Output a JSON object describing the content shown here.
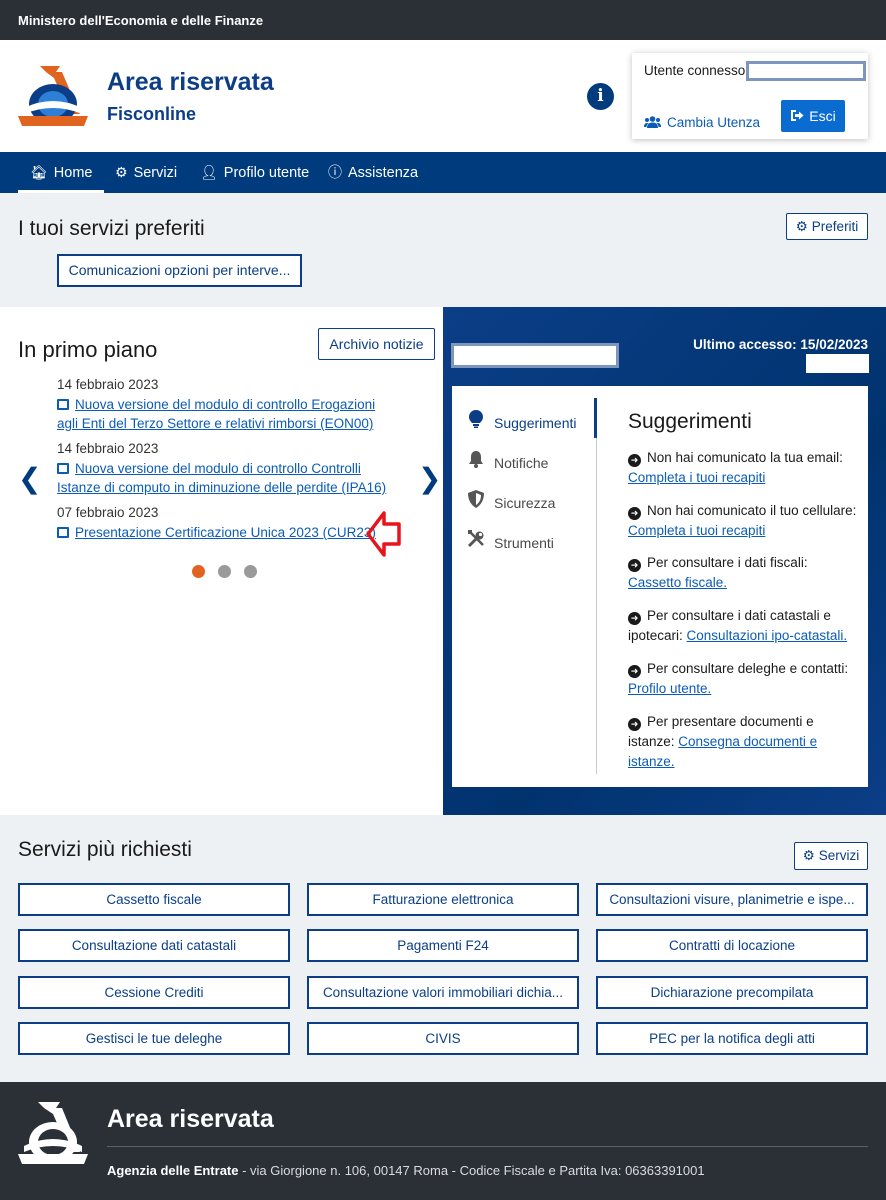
{
  "topbar": {
    "ministry": "Ministero dell'Economia e delle Finanze"
  },
  "header": {
    "title": "Area riservata",
    "subtitle": "Fisconline",
    "info_glyph": "i",
    "user_label": "Utente connesso:",
    "switch_user": "Cambia Utenza",
    "logout": "Esci"
  },
  "nav": {
    "items": [
      {
        "label": "Home",
        "icon": "home-icon"
      },
      {
        "label": "Servizi",
        "icon": "cogs-icon"
      },
      {
        "label": "Profilo utente",
        "icon": "user-icon"
      },
      {
        "label": "Assistenza",
        "icon": "info-icon"
      }
    ]
  },
  "favorites": {
    "title": "I tuoi servizi preferiti",
    "button": "Preferiti",
    "items": [
      "Comunicazioni opzioni per interve..."
    ]
  },
  "news": {
    "title": "In primo piano",
    "archive_button": "Archivio notizie",
    "items": [
      {
        "date": "14 febbraio 2023",
        "text": "Nuova versione del modulo di controllo Erogazioni agli Enti del Terzo Settore e relativi rimborsi (EON00)"
      },
      {
        "date": "14 febbraio 2023",
        "text": "Nuova versione del modulo di controllo Controlli Istanze di computo in diminuzione delle perdite (IPA16)"
      },
      {
        "date": "07 febbraio 2023",
        "text": "Presentazione Certificazione Unica 2023 (CUR23)"
      }
    ],
    "prev": "❮",
    "next": "❯",
    "slide_count": 3,
    "active_slide": 0
  },
  "panel": {
    "last_access": "Ultimo accesso: 15/02/2023",
    "tabs": [
      {
        "label": "Suggerimenti",
        "icon": "lightbulb-icon",
        "active": true
      },
      {
        "label": "Notifiche",
        "icon": "bell-icon",
        "active": false
      },
      {
        "label": "Sicurezza",
        "icon": "shield-icon",
        "active": false
      },
      {
        "label": "Strumenti",
        "icon": "tools-icon",
        "active": false
      }
    ],
    "tips_title": "Suggerimenti",
    "tips": [
      {
        "text": "Non hai comunicato la tua email:",
        "link": "Completa i tuoi recapiti"
      },
      {
        "text": "Non hai comunicato il tuo cellulare:",
        "link": "Completa i tuoi recapiti"
      },
      {
        "text": "Per consultare i dati fiscali:",
        "link": "Cassetto fiscale."
      },
      {
        "text": "Per consultare i dati catastali e ipotecari:",
        "link": "Consultazioni ipo-catastali."
      },
      {
        "text": "Per consultare deleghe e contatti:",
        "link": "Profilo utente."
      },
      {
        "text": "Per presentare documenti e istanze:",
        "link": "Consegna documenti e istanze."
      }
    ]
  },
  "services": {
    "title": "Servizi più richiesti",
    "button": "Servizi",
    "items": [
      "Cassetto fiscale",
      "Fatturazione elettronica",
      "Consultazioni visure, planimetrie e ispe...",
      "Consultazione dati catastali",
      "Pagamenti F24",
      "Contratti di locazione",
      "Cessione Crediti",
      "Consultazione valori immobiliari dichia...",
      "Dichiarazione precompilata",
      "Gestisci le tue deleghe",
      "CIVIS",
      "PEC per la notifica degli atti"
    ]
  },
  "footer": {
    "title": "Area riservata",
    "agency": "Agenzia delle Entrate",
    "address": " - via Giorgione n. 106, 00147 Roma - Codice Fiscale e Partita Iva: 06363391001"
  },
  "colors": {
    "brand_blue": "#003c7d",
    "link_blue": "#0b5cb8",
    "accent_orange": "#e0641f",
    "annotation_red": "#e8141c"
  }
}
